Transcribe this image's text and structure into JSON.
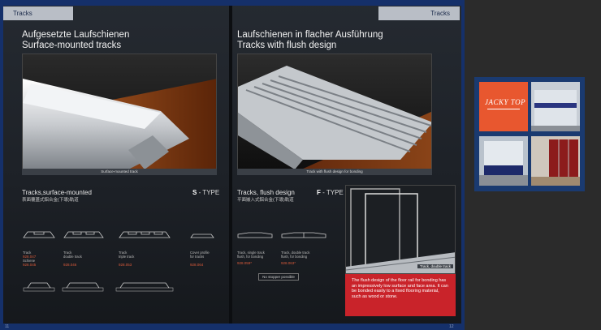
{
  "left_page": {
    "tab_label": "Tracks",
    "heading_de": "Aufgesetzte Laufschienen",
    "heading_en": "Surface-mounted tracks",
    "photo_caption": "Surface-mounted track",
    "section_title": "Tracks,surface-mounted",
    "section_sub": "表面覆蓋式鋁合金(下導)軌道",
    "type_letter": "S",
    "type_suffix": " - TYPE",
    "profiles": [
      {
        "name": "Track",
        "name2": "Schiene",
        "codes": [
          "928.047",
          "928.045"
        ]
      },
      {
        "name": "Track",
        "name2": "double track",
        "codes": [
          "928.046"
        ]
      },
      {
        "name": "Track",
        "name2": "triple track",
        "codes": [
          "928.053"
        ]
      },
      {
        "name": "Cover profile",
        "name2": "for tracks",
        "codes": [
          "928.064"
        ]
      }
    ],
    "page_number": "11"
  },
  "right_page": {
    "tab_label": "Tracks",
    "heading_de": "Laufschienen in flacher Ausführung",
    "heading_en": "Tracks with flush design",
    "photo_caption": "Track with flush design for bonding",
    "section_title": "Tracks, flush design",
    "section_sub": "平面嵌入式鋁合金(下導)軌道",
    "type_letter": "F",
    "type_suffix": " - TYPE",
    "profiles": [
      {
        "name": "Track, single track",
        "name2": "flush, for bonding",
        "codes": [
          "928.059*"
        ]
      },
      {
        "name": "Track, double track",
        "name2": "flush, for bonding",
        "codes": [
          "928.063*"
        ]
      }
    ],
    "no_stopper": "No stopper possible",
    "inset_caption": "Track, double track",
    "note": "The flush design of the floor rail for bonding has an impressively low surface and face area. It can be bonded easily to a fixed flooring material, such as wood or stone.",
    "page_number": "12"
  },
  "promo": {
    "logo_text": "JACKY TOP"
  },
  "colors": {
    "frame": "#15306a",
    "accent_red": "#c9232a",
    "logo_orange": "#e8572f"
  }
}
